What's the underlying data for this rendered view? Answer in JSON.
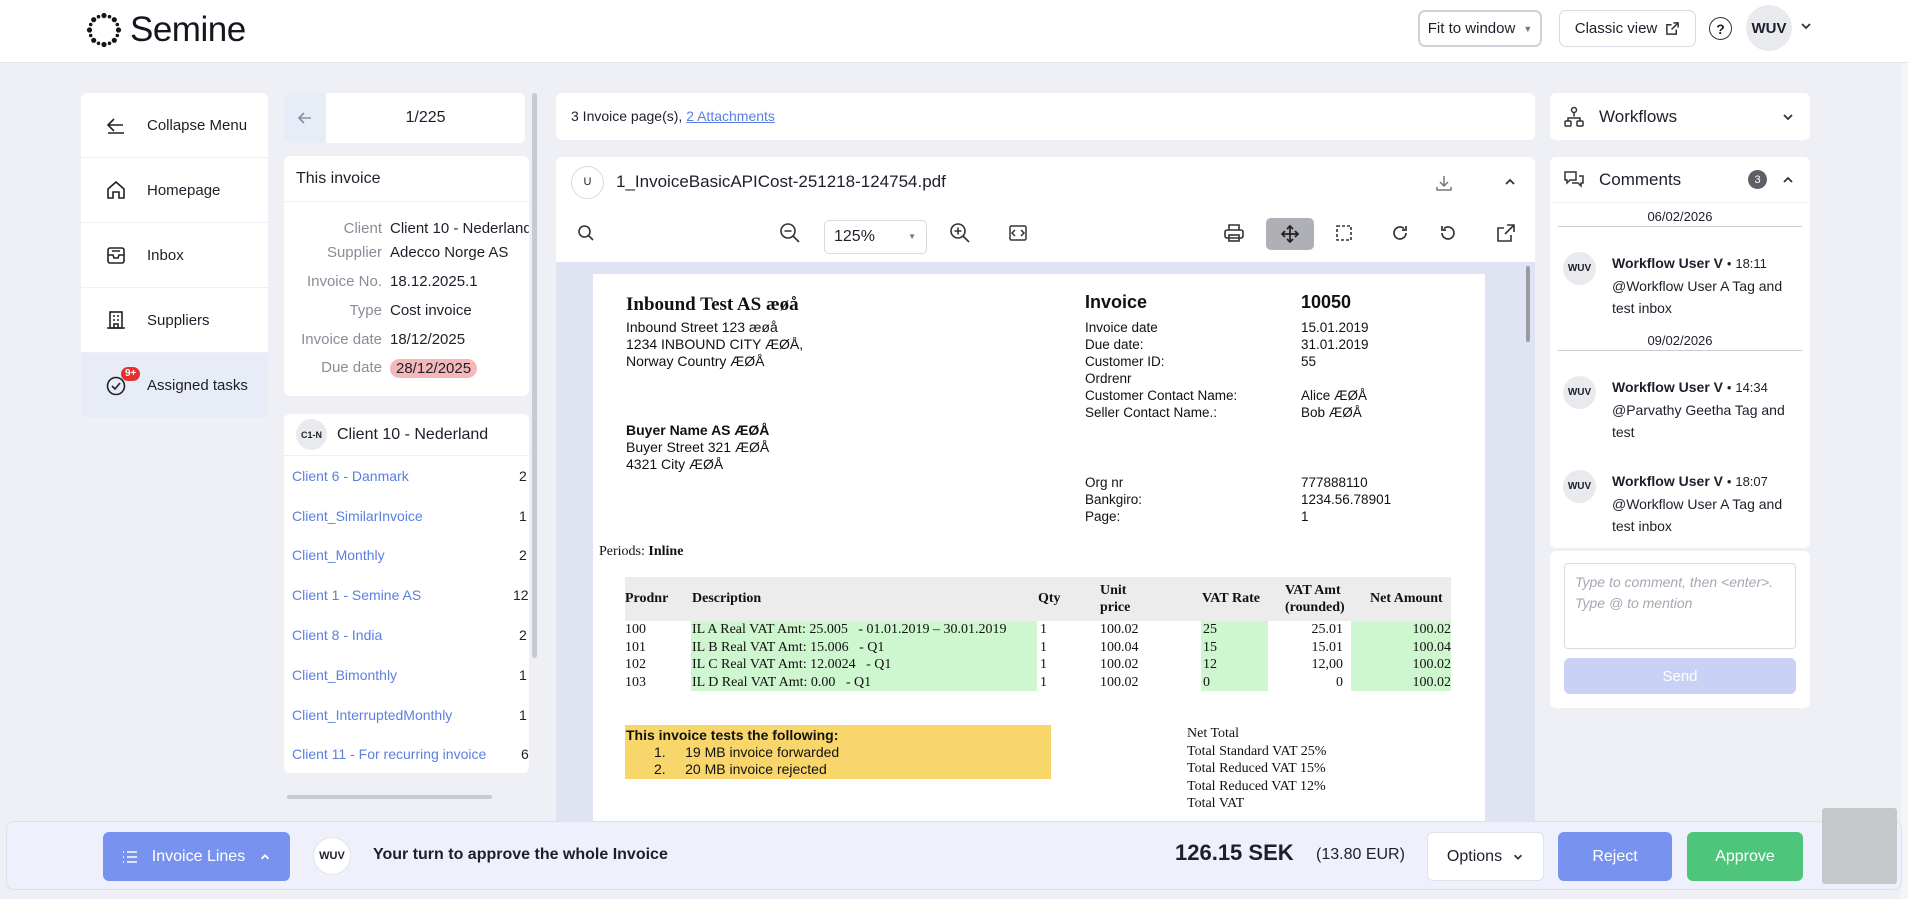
{
  "header": {
    "logo_text": "Semine",
    "fit_label": "Fit to window",
    "classic_label": "Classic view",
    "help_glyph": "?",
    "user_initials": "WUV"
  },
  "nav": {
    "items": [
      {
        "label": "Collapse Menu",
        "icon": "arrow-left-icon"
      },
      {
        "label": "Homepage",
        "icon": "home-icon"
      },
      {
        "label": "Inbox",
        "icon": "inbox-icon"
      },
      {
        "label": "Suppliers",
        "icon": "building-icon"
      },
      {
        "label": "Assigned tasks",
        "icon": "check-circle-icon",
        "badge": "9+"
      }
    ]
  },
  "pager": {
    "text": "1/225"
  },
  "this_invoice": {
    "title": "This invoice",
    "client_label": "Client",
    "client_value": "Client 10 - Nederland",
    "supplier_label": "Supplier",
    "supplier_value": "Adecco Norge AS",
    "invoice_no_label": "Invoice No.",
    "invoice_no_value": "18.12.2025.1",
    "type_label": "Type",
    "type_value": "Cost invoice",
    "invoice_date_label": "Invoice date",
    "invoice_date_value": "18/12/2025",
    "due_date_label": "Due date",
    "due_date_value": "28/12/2025"
  },
  "client_list": {
    "current_avatar": "C1-N",
    "current_name": "Client 10 - Nederland",
    "rows": [
      {
        "name": "Client 6 - Danmark",
        "count": "2"
      },
      {
        "name": "Client_SimilarInvoice",
        "count": "1"
      },
      {
        "name": "Client_Monthly",
        "count": "2"
      },
      {
        "name": "Client 1 - Semine AS",
        "count": "12"
      },
      {
        "name": "Client 8 - India",
        "count": "2"
      },
      {
        "name": "Client_Bimonthly",
        "count": "1"
      },
      {
        "name": "Client_InterruptedMonthly",
        "count": "1"
      },
      {
        "name": "Client 11 - For recurring invoice",
        "count": "6"
      }
    ]
  },
  "attachments": {
    "pages_text": "3 Invoice page(s),",
    "link_text": "2 Attachments"
  },
  "document": {
    "uploader": "U",
    "filename": "1_InvoiceBasicAPICost-251218-124754.pdf",
    "zoom": "125%"
  },
  "invoice": {
    "company": "Inbound Test AS æøå",
    "addr1": "Inbound Street 123 æøå",
    "addr2": "1234 INBOUND CITY ÆØÅ,",
    "addr3": "Norway Country ÆØÅ",
    "buyer_name": "Buyer Name AS ÆØÅ",
    "buyer_addr1": "Buyer Street 321 ÆØÅ",
    "buyer_addr2": "4321 City ÆØÅ",
    "title": "Invoice",
    "number": "10050",
    "meta_labels": [
      "Invoice date",
      "Due date:",
      "Customer ID:",
      "Ordrenr",
      "Customer Contact Name:",
      "Seller Contact Name.:"
    ],
    "meta_values": [
      "15.01.2019",
      "31.01.2019",
      "55",
      "",
      "Alice ÆØÅ",
      "Bob ÆØÅ"
    ],
    "bank_labels": [
      "Org nr",
      "Bankgiro:",
      "Page:"
    ],
    "bank_values": [
      "777888110",
      "1234.56.78901",
      "1"
    ],
    "periods_label": "Periods:",
    "periods_value": "Inline",
    "table_headers": {
      "prodnr": "Prodnr",
      "description": "Description",
      "qty": "Qty",
      "unit_price_1": "Unit",
      "unit_price_2": "price",
      "vat_rate": "VAT Rate",
      "vat_amt_1": "VAT Amt",
      "vat_amt_2": "(rounded)",
      "net_amount": "Net Amount"
    },
    "lines": [
      {
        "prodnr": "100",
        "description": "IL A Real VAT Amt: 25.005   - 01.01.2019 – 30.01.2019",
        "qty": "1",
        "unit_price": "100.02",
        "vat_rate": "25",
        "vat_amt": "25.01",
        "net": "100.02"
      },
      {
        "prodnr": "101",
        "description": "IL B Real VAT Amt: 15.006   - Q1",
        "qty": "1",
        "unit_price": "100.04",
        "vat_rate": "15",
        "vat_amt": "15.01",
        "net": "100.04"
      },
      {
        "prodnr": "102",
        "description": "IL C Real VAT Amt: 12.0024   - Q1",
        "qty": "1",
        "unit_price": "100.02",
        "vat_rate": "12",
        "vat_amt": "12,00",
        "net": "100.02"
      },
      {
        "prodnr": "103",
        "description": "IL D Real VAT Amt: 0.00   - Q1",
        "qty": "1",
        "unit_price": "100.02",
        "vat_rate": "0",
        "vat_amt": "0",
        "net": "100.02"
      }
    ],
    "tests_title": "This invoice tests the following:",
    "tests": [
      "1.     19 MB invoice forwarded",
      "2.     20 MB invoice rejected"
    ],
    "totals": [
      "Net Total",
      "Total Standard VAT 25%",
      "Total Reduced VAT 15%",
      "Total Reduced VAT 12%",
      "Total VAT"
    ]
  },
  "workflows": {
    "title": "Workflows"
  },
  "comments": {
    "title": "Comments",
    "count": "3",
    "date1": "06/02/2026",
    "date2": "09/02/2026",
    "items": [
      {
        "avatar": "WUV",
        "author": "Workflow User V",
        "time": "18:11",
        "text": "@Workflow User A Tag and test inbox"
      },
      {
        "avatar": "WUV",
        "author": "Workflow User V",
        "time": "14:34",
        "text": "@Parvathy Geetha Tag and test"
      },
      {
        "avatar": "WUV",
        "author": "Workflow User V",
        "time": "18:07",
        "text": "@Workflow User A Tag and test inbox"
      }
    ],
    "placeholder": "Type to comment, then <enter>. Type @ to mention",
    "send_label": "Send"
  },
  "footer": {
    "lines_label": "Invoice Lines",
    "avatar": "WUV",
    "turn_text": "Your turn to approve the whole Invoice",
    "amount": "126.15 SEK",
    "amount_eur": "(13.80 EUR)",
    "options_label": "Options",
    "reject_label": "Reject",
    "approve_label": "Approve"
  }
}
